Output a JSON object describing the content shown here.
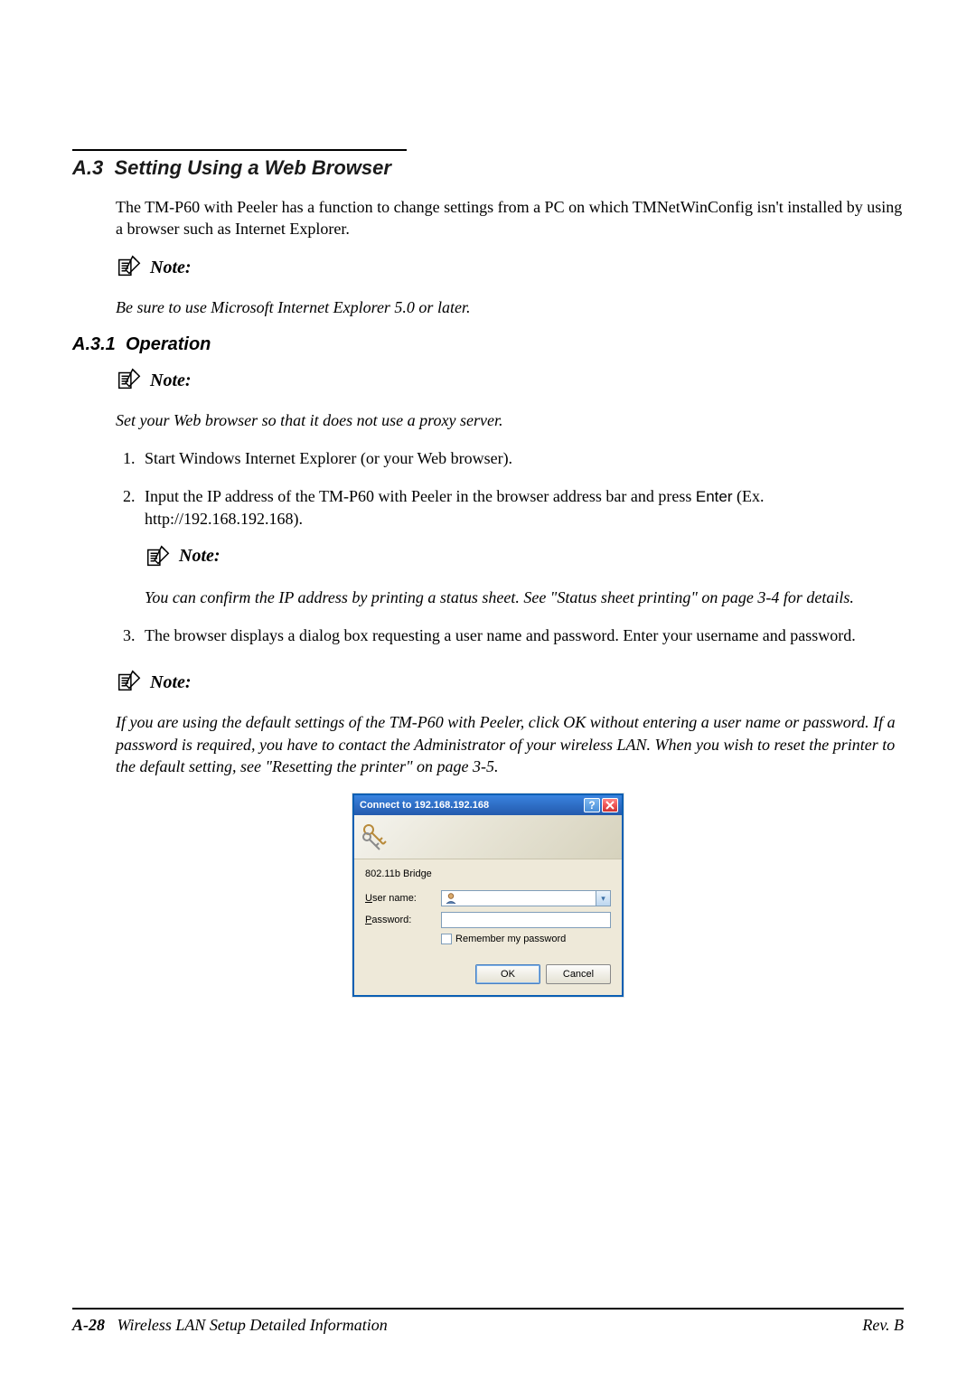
{
  "section": {
    "number": "A.3",
    "title": "Setting Using a Web Browser",
    "intro": "The TM-P60 with Peeler has a function to change settings from a PC on which TMNetWinConfig isn't installed by using a browser such as Internet Explorer."
  },
  "note_label": "Note:",
  "note1": "Be sure to use Microsoft Internet Explorer 5.0 or later.",
  "subsection": {
    "number": "A.3.1",
    "title": "Operation"
  },
  "note2": "Set your Web browser so that it does not use a proxy server.",
  "steps": {
    "s1": "Start Windows Internet Explorer (or your Web browser).",
    "s2a": "Input the IP address of the TM-P60 with Peeler in the browser address bar and press ",
    "s2_key": "Enter",
    "s2b": " (Ex. http://192.168.192.168).",
    "s3": "The browser displays a dialog box requesting a user name and password. Enter your username and password."
  },
  "note3": "You can confirm the IP address by printing a status sheet. See \"Status sheet printing\" on page 3-4 for details.",
  "note4": "If you are using the default settings of the TM-P60 with Peeler, click OK without entering a user name or password. If a password is required, you have to contact the Administrator of your wireless LAN. When you wish to reset the printer to the default setting, see \"Resetting the printer\" on page 3-5.",
  "dialog": {
    "title": "Connect to 192.168.192.168",
    "realm": "802.11b Bridge",
    "user_label_pre": "U",
    "user_label_post": "ser name:",
    "pass_label_pre": "P",
    "pass_label_post": "assword:",
    "remember_pre": "R",
    "remember_post": "emember my password",
    "ok": "OK",
    "cancel": "Cancel"
  },
  "footer": {
    "page": "A-28",
    "doc": "Wireless LAN Setup Detailed Information",
    "rev": "Rev. B"
  }
}
